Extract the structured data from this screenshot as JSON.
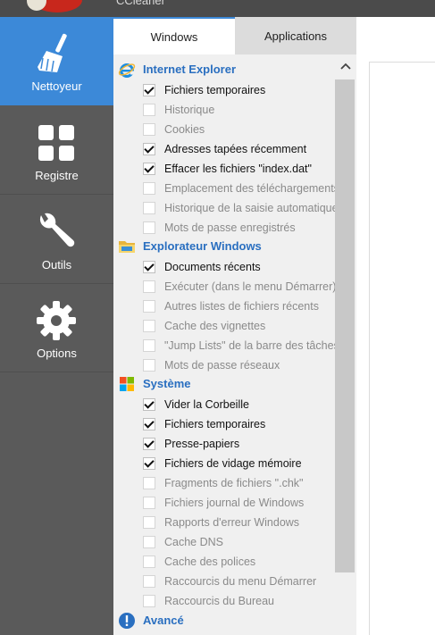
{
  "window": {
    "title": "CCleaner"
  },
  "sidebar": {
    "items": [
      {
        "label": "Nettoyeur",
        "icon": "broom-icon",
        "active": true
      },
      {
        "label": "Registre",
        "icon": "grid-icon",
        "active": false
      },
      {
        "label": "Outils",
        "icon": "wrench-icon",
        "active": false
      },
      {
        "label": "Options",
        "icon": "gear-icon",
        "active": false
      }
    ]
  },
  "tabs": [
    {
      "label": "Windows",
      "active": true
    },
    {
      "label": "Applications",
      "active": false
    }
  ],
  "sections": {
    "ie": {
      "title": "Internet Explorer",
      "icon": "internet-explorer-icon",
      "items": [
        {
          "label": "Fichiers temporaires",
          "checked": true
        },
        {
          "label": "Historique",
          "checked": false
        },
        {
          "label": "Cookies",
          "checked": false
        },
        {
          "label": "Adresses tapées récemment",
          "checked": true
        },
        {
          "label": "Effacer les fichiers \"index.dat\"",
          "checked": true
        },
        {
          "label": "Emplacement des téléchargements",
          "checked": false
        },
        {
          "label": "Historique de la saisie automatique",
          "checked": false
        },
        {
          "label": "Mots de passe enregistrés",
          "checked": false
        }
      ]
    },
    "explorer": {
      "title": "Explorateur Windows",
      "icon": "folder-icon",
      "items": [
        {
          "label": "Documents récents",
          "checked": true
        },
        {
          "label": "Exécuter (dans le menu Démarrer)",
          "checked": false
        },
        {
          "label": "Autres listes de fichiers récents",
          "checked": false
        },
        {
          "label": "Cache des vignettes",
          "checked": false
        },
        {
          "label": "\"Jump Lists\" de la barre des tâches",
          "checked": false
        },
        {
          "label": "Mots de passe réseaux",
          "checked": false
        }
      ]
    },
    "system": {
      "title": "Système",
      "icon": "windows-logo-icon",
      "items": [
        {
          "label": "Vider la Corbeille",
          "checked": true
        },
        {
          "label": "Fichiers temporaires",
          "checked": true
        },
        {
          "label": "Presse-papiers",
          "checked": true
        },
        {
          "label": "Fichiers de vidage mémoire",
          "checked": true
        },
        {
          "label": "Fragments de fichiers \".chk\"",
          "checked": false
        },
        {
          "label": "Fichiers journal de Windows",
          "checked": false
        },
        {
          "label": "Rapports d'erreur Windows",
          "checked": false
        },
        {
          "label": "Cache DNS",
          "checked": false
        },
        {
          "label": "Cache des polices",
          "checked": false
        },
        {
          "label": "Raccourcis du menu Démarrer",
          "checked": false
        },
        {
          "label": "Raccourcis du Bureau",
          "checked": false
        }
      ]
    },
    "advanced": {
      "title": "Avancé",
      "icon": "info-exclamation-icon",
      "items": []
    }
  },
  "colors": {
    "accent": "#3c89d8",
    "sidebar": "#5a5a5a",
    "section_title": "#2a6fc0"
  }
}
